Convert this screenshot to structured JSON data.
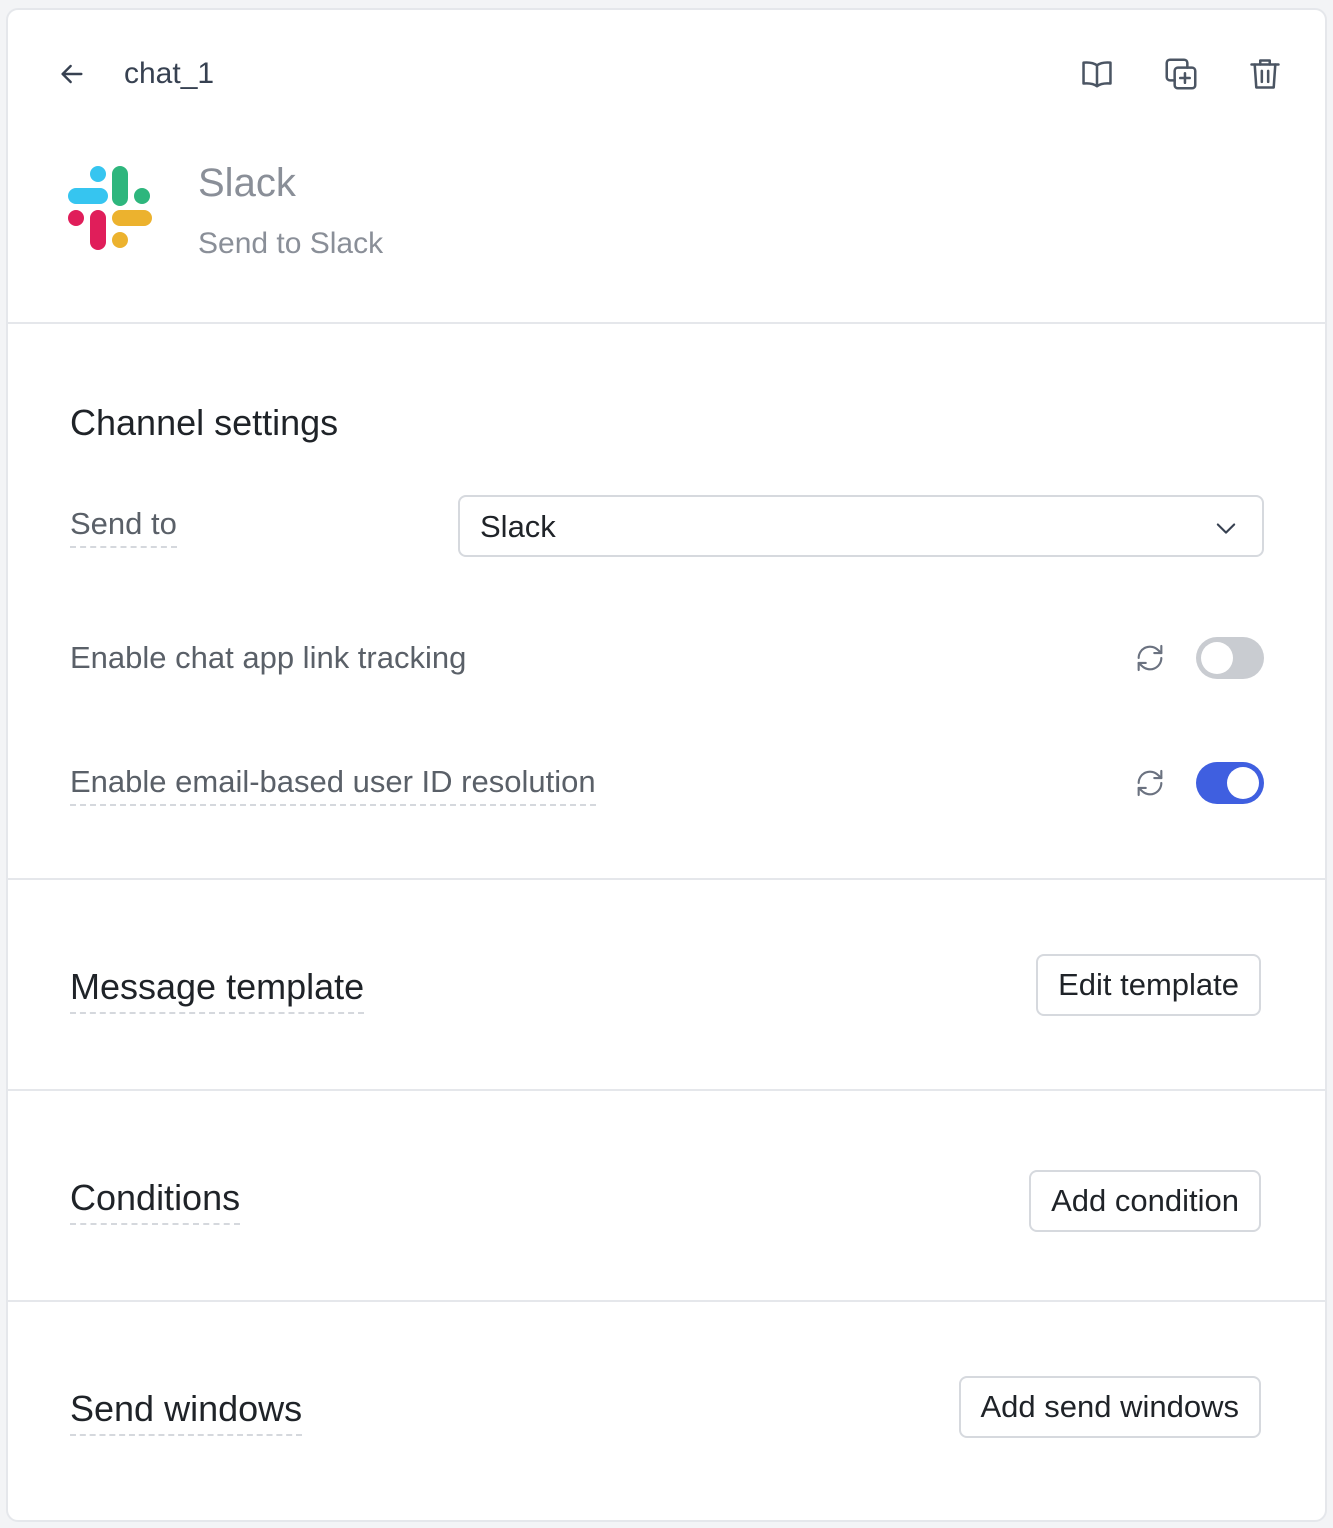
{
  "header": {
    "step_name": "chat_1",
    "icons": [
      "arrow-left-icon",
      "book-open-icon",
      "duplicate-icon",
      "trash-icon"
    ]
  },
  "app": {
    "name": "Slack",
    "description": "Send to Slack",
    "logo_colors": {
      "blue": "#36c5f0",
      "green": "#2eb67d",
      "red": "#e01e5a",
      "yellow": "#ecb22e"
    }
  },
  "channel_settings": {
    "title": "Channel settings",
    "send_to_label": "Send to",
    "send_to_value": "Slack",
    "link_tracking_label": "Enable chat app link tracking",
    "link_tracking_enabled": false,
    "email_resolution_label": "Enable email-based user ID resolution",
    "email_resolution_enabled": true
  },
  "message_template": {
    "title": "Message template",
    "button": "Edit template"
  },
  "conditions": {
    "title": "Conditions",
    "button": "Add condition"
  },
  "send_windows": {
    "title": "Send windows",
    "button": "Add send windows"
  },
  "colors": {
    "accent": "#3f5fe0",
    "toggle_off": "#c9ccd1"
  }
}
